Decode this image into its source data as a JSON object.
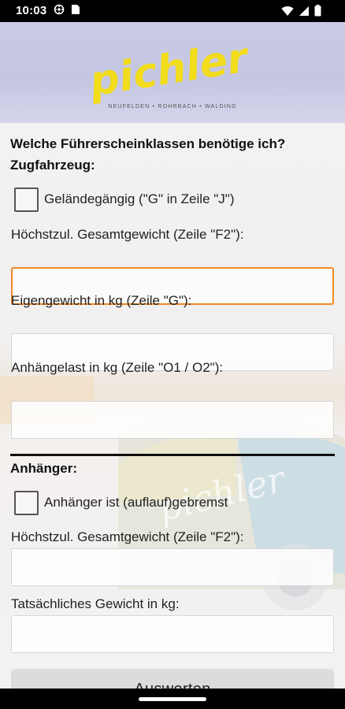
{
  "status_bar": {
    "time": "10:03",
    "left_icons": [
      "vpn-key-icon",
      "sim-card-icon"
    ],
    "right_icons": [
      "wifi-icon",
      "cellular-signal-icon",
      "battery-icon"
    ]
  },
  "header": {
    "logo_text": "pichler",
    "logo_subtitle": "NEUFELDEN • ROHRBACH • WALDING",
    "logo_color": "#f2dc1c"
  },
  "form": {
    "question": "Welche Führerscheinklassen benötige ich?",
    "towing_section_label": "Zugfahrzeug:",
    "offroad_label": "Geländegängig (\"G\" in Zeile \"J\")",
    "offroad_checked": false,
    "towing_max_weight_label": "Höchstzul. Gesamtgewicht (Zeile \"F2\"):",
    "towing_max_weight_value": "",
    "curb_weight_label": "Eigengewicht in kg (Zeile \"G\"):",
    "curb_weight_value": "",
    "towing_capacity_label": "Anhängelast in kg  (Zeile \"O1 / O2\"):",
    "towing_capacity_value": "",
    "trailer_section_label": "Anhänger:",
    "trailer_braked_label": "Anhänger ist (auflauf)gebremst",
    "trailer_braked_checked": false,
    "trailer_max_weight_label": "Höchstzul. Gesamtgewicht (Zeile \"F2\"):",
    "trailer_max_weight_value": "",
    "actual_weight_label": "Tatsächliches Gewicht in kg:",
    "actual_weight_value": "",
    "evaluate_button": "Auswerten",
    "focus_color": "#f08a24"
  }
}
